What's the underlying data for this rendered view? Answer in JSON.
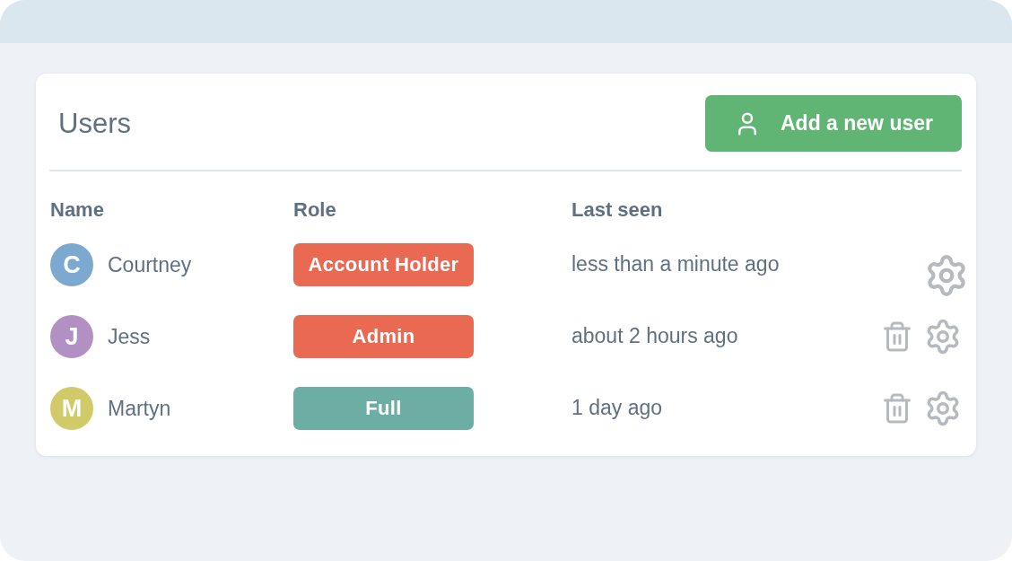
{
  "card": {
    "title": "Users",
    "add_button": {
      "label": "Add a new user"
    }
  },
  "table": {
    "columns": [
      "Name",
      "Role",
      "Last seen"
    ],
    "rows": [
      {
        "avatar": {
          "initial": "C",
          "color": "#7ba9cf"
        },
        "name": "Courtney",
        "role": {
          "label": "Account Holder",
          "color": "#e96952"
        },
        "last_seen": "less than a minute ago",
        "deletable": false
      },
      {
        "avatar": {
          "initial": "J",
          "color": "#b390c3"
        },
        "name": "Jess",
        "role": {
          "label": "Admin",
          "color": "#e96952"
        },
        "last_seen": "about 2 hours ago",
        "deletable": true
      },
      {
        "avatar": {
          "initial": "M",
          "color": "#d0cb68"
        },
        "name": "Martyn",
        "role": {
          "label": "Full",
          "color": "#6daea4"
        },
        "last_seen": "1 day ago",
        "deletable": true
      }
    ]
  }
}
